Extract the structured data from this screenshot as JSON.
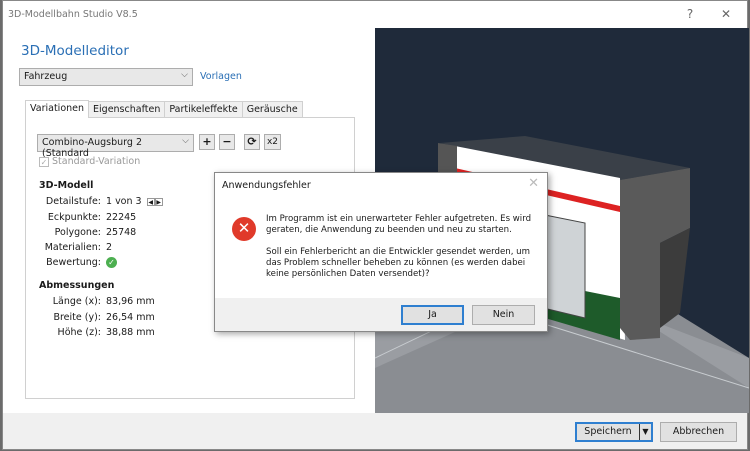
{
  "window": {
    "title": "3D-Modellbahn Studio V8.5",
    "help_label": "?",
    "close_label": "✕"
  },
  "editor": {
    "heading": "3D-Modelleditor",
    "category_select": "Fahrzeug",
    "templates_link": "Vorlagen",
    "tabs": [
      {
        "label": "Variationen",
        "active": true
      },
      {
        "label": "Eigenschaften"
      },
      {
        "label": "Partikeleffekte"
      },
      {
        "label": "Geräusche"
      }
    ],
    "variation_select": "Combino-Augsburg 2 (Standard",
    "add_label": "+",
    "remove_label": "−",
    "refresh_label": "⟳",
    "x2_label": "x2",
    "standard_checkbox": {
      "label": "Standard-Variation",
      "checked": true,
      "disabled": true
    },
    "model_section": {
      "title": "3D-Modell",
      "rows": [
        {
          "label": "Detailstufe:",
          "value": "1 von 3"
        },
        {
          "label": "Eckpunkte:",
          "value": "22245"
        },
        {
          "label": "Polygone:",
          "value": "25748"
        },
        {
          "label": "Materialien:",
          "value": "2"
        },
        {
          "label": "Bewertung:",
          "value": "",
          "icon": "check-circle-icon",
          "color": "#4caf50"
        }
      ]
    },
    "dimensions_section": {
      "title": "Abmessungen",
      "rows": [
        {
          "label": "Länge (x):",
          "value": "83,96 mm"
        },
        {
          "label": "Breite (y):",
          "value": "26,54 mm"
        },
        {
          "label": "Höhe (z):",
          "value": "38,88 mm"
        }
      ]
    }
  },
  "footer": {
    "save_label": "Speichern",
    "cancel_label": "Abbrechen"
  },
  "dialog": {
    "title": "Anwendungsfehler",
    "icon": "error-icon",
    "message1": "Im Programm ist ein unerwarteter Fehler aufgetreten. Es wird geraten, die Anwendung zu beenden und neu zu starten.",
    "message2": "Soll ein Fehlerbericht an die Entwickler gesendet werden, um das Problem schneller beheben zu können (es werden dabei keine persönlichen Daten versendet)?",
    "yes_label": "Ja",
    "no_label": "Nein"
  },
  "colors": {
    "accent": "#2a6fb5",
    "error": "#e03a2a",
    "viewport_bg": "#1f2a3a"
  }
}
